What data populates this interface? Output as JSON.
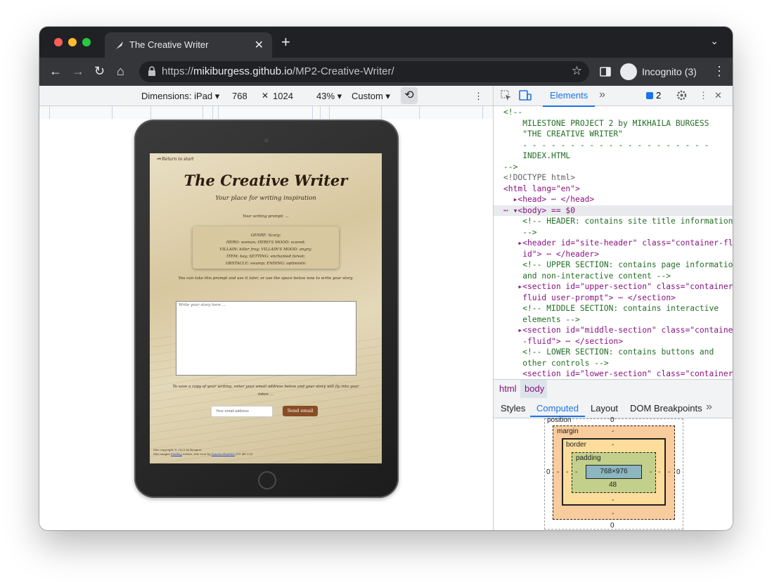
{
  "browser": {
    "tab_title": "The Creative Writer",
    "tab_close": "✕",
    "new_tab": "+",
    "tab_search": "⌄",
    "nav": {
      "back": "←",
      "forward": "→",
      "reload": "↻",
      "home": "⌂"
    },
    "url_prefix": "https://",
    "url_host": "mikiburgess.github.io",
    "url_path": "/MP2-Creative-Writer/",
    "star": "☆",
    "incognito_label": "Incognito (3)",
    "menu": "⋮"
  },
  "device_toolbar": {
    "dimensions": "Dimensions: iPad ▾",
    "width": "768",
    "times": "✕",
    "height": "1024",
    "zoom": "43% ▾",
    "throttle": "Custom ▾",
    "rotate": "⟲",
    "more": "⋮"
  },
  "site": {
    "back_link": "⏮ Return to start",
    "title": "The Creative Writer",
    "subtitle": "Your place for writing inspiration",
    "prompt_heading": "Your writing prompt: ...",
    "prompt_lines": [
      "GENRE: Scary;",
      "HERO: woman; HERO'S MOOD: scared;",
      "VILLAIN: killer frog; VILLAIN'S MOOD: angry;",
      "ITEM: key; SETTING: enchanted forest;",
      "OBSTACLE: swamp; ENDING: optimistic"
    ],
    "take_text": "You can take this prompt and use it later, or use the space below now to write your story.",
    "story_placeholder": "Write your story here ...",
    "save_text": "To save a copy of your writing, enter your email address below and your story will fly into your inbox ...",
    "email_placeholder": "Your email address",
    "send_button": "Send email",
    "footer_line1": "Site copyright © 2023 M Burgess",
    "footer_line2_pre": "Site images ",
    "footer_link1": "Pixabay",
    "footer_line2_mid": " artists; Site icon by ",
    "footer_link2": "Sancho Huaman",
    "footer_line2_post": " (CC BY 3.0)"
  },
  "devtools": {
    "tab_elements": "Elements",
    "more_tabs": "»",
    "issues_count": "2",
    "code_lines": [
      {
        "cls": "c-cm",
        "text": "<!--"
      },
      {
        "cls": "c-cm",
        "text": "    MILESTONE PROJECT 2 by MIKHAILA BURGESS"
      },
      {
        "cls": "c-cm",
        "text": "    \"THE CREATIVE WRITER\""
      },
      {
        "cls": "c-cm",
        "text": "    - - - - - - - - - - - - - - - - - - - -"
      },
      {
        "cls": "c-cm",
        "text": "    INDEX.HTML"
      },
      {
        "cls": "c-cm",
        "text": "-->"
      },
      {
        "cls": "c-gr",
        "text": "<!DOCTYPE html>"
      },
      {
        "cls": "c-tag",
        "text": "<html lang=\"en\">"
      },
      {
        "cls": "c-tag",
        "text": "  ▸<head> ⋯ </head>"
      },
      {
        "cls": "c-tag hl",
        "text": "⋯ ▾<body> == $0"
      },
      {
        "cls": "c-cm",
        "text": "    <!-- HEADER: contains site title information"
      },
      {
        "cls": "c-cm",
        "text": "    -->"
      },
      {
        "cls": "c-tag",
        "text": "   ▸<header id=\"site-header\" class=\"container-flu"
      },
      {
        "cls": "c-tag",
        "text": "    id\"> ⋯ </header>"
      },
      {
        "cls": "c-cm",
        "text": "    <!-- UPPER SECTION: contains page information"
      },
      {
        "cls": "c-cm",
        "text": "    and non-interactive content -->"
      },
      {
        "cls": "c-tag",
        "text": "   ▸<section id=\"upper-section\" class=\"container-"
      },
      {
        "cls": "c-tag",
        "text": "    fluid user-prompt\"> ⋯ </section>"
      },
      {
        "cls": "c-cm",
        "text": "    <!-- MIDDLE SECTION: contains interactive"
      },
      {
        "cls": "c-cm",
        "text": "    elements -->"
      },
      {
        "cls": "c-tag",
        "text": "   ▸<section id=\"middle-section\" class=\"container"
      },
      {
        "cls": "c-tag",
        "text": "    -fluid\"> ⋯ </section>"
      },
      {
        "cls": "c-cm",
        "text": "    <!-- LOWER SECTION: contains buttons and"
      },
      {
        "cls": "c-cm",
        "text": "    other controls -->"
      },
      {
        "cls": "c-tag",
        "text": "    <section id=\"lower-section\" class=\"container-"
      }
    ],
    "crumb_html": "html",
    "crumb_body": "body",
    "subtabs": [
      "Styles",
      "Computed",
      "Layout",
      "DOM Breakpoints",
      "»"
    ],
    "box": {
      "position_label": "position",
      "position_value": "0",
      "margin_label": "margin",
      "border_label": "border",
      "padding_label": "padding",
      "content": "768×976",
      "padding_bottom": "48",
      "dash": "-",
      "zero": "0"
    },
    "colors": {
      "accent": "#1a73e8",
      "margin": "#f9cc9d",
      "border": "#fddd9b",
      "padding": "#c3d08b",
      "content": "#8cb6c0"
    }
  }
}
